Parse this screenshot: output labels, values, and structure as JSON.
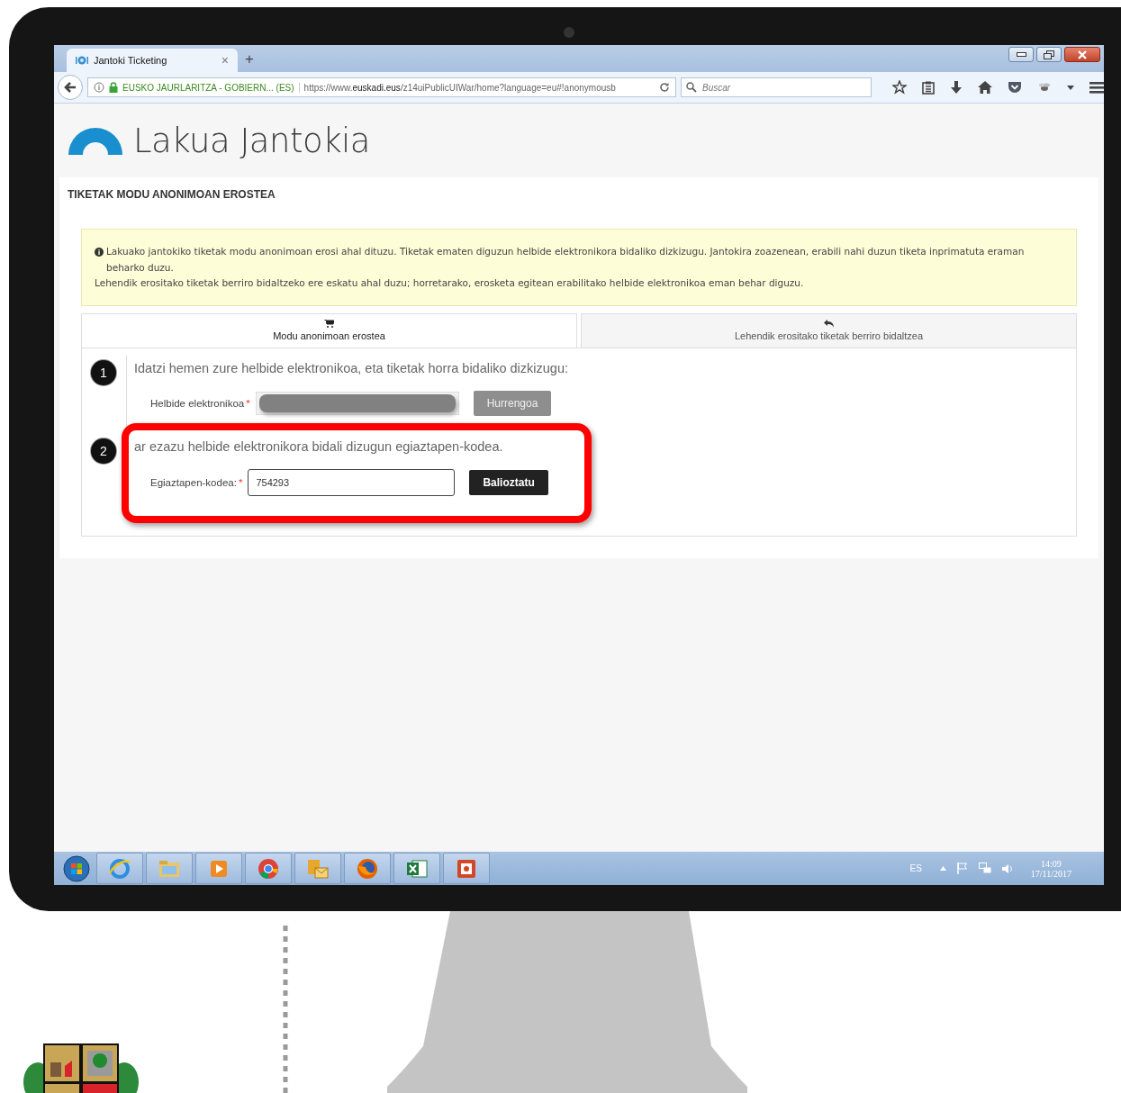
{
  "browser": {
    "tab": {
      "title": "Jantoki Ticketing",
      "close": "×"
    },
    "new_tab": "+",
    "site_identity": "EUSKO JAURLARITZA - GOBIERN... (ES)",
    "url": "https://www.**euskadi.eus**/z14uiPublicUIWar/home?language=eu#!anonymousb",
    "search": {
      "placeholder": "Buscar"
    }
  },
  "page": {
    "title": "Lakua Jantokia",
    "heading": "TIKETAK MODU ANONIMOAN EROSTEA",
    "alert": [
      "Lakuako jantokiko tiketak modu anonimoan erosi ahal dituzu. Tiketak ematen diguzun helbide elektronikora bidaliko dizkizugu. Jantokira zoazenean, erabili nahi duzun tiketa inprimatuta eraman beharko duzu.",
      "Lehendik erositako tiketak berriro bidaltzeko ere eskatu ahal duzu; horretarako, erosketa egitean erabilitako helbide elektronikoa eman behar diguzu."
    ],
    "tabs": [
      {
        "label": "Modu anonimoan erostea",
        "selected": true
      },
      {
        "label": "Lehendik erositako tiketak berriro bidaltzea",
        "selected": false
      }
    ],
    "steps": [
      {
        "number": "1",
        "instruction": "Idatzi hemen zure helbide elektronikoa, eta tiketak horra bidaliko dizkizugu:",
        "field_label": "Helbide elektronikoa",
        "required_mark": "*",
        "field": {
          "kind": "redacted"
        },
        "button": {
          "label": "Hurrengoa",
          "disabled": true
        },
        "highlighted": false
      },
      {
        "number": "2",
        "instruction": "ar ezazu helbide elektronikora bidali dizugun egiaztapen-kodea.",
        "field_label": "Egiaztapen-kodea:",
        "required_mark": "*",
        "field": {
          "kind": "text",
          "value": "754293"
        },
        "button": {
          "label": "Balioztatu",
          "disabled": false
        },
        "highlighted": true
      }
    ]
  },
  "taskbar": {
    "language": "ES",
    "time": "14:09",
    "date": "17/11/2017"
  }
}
